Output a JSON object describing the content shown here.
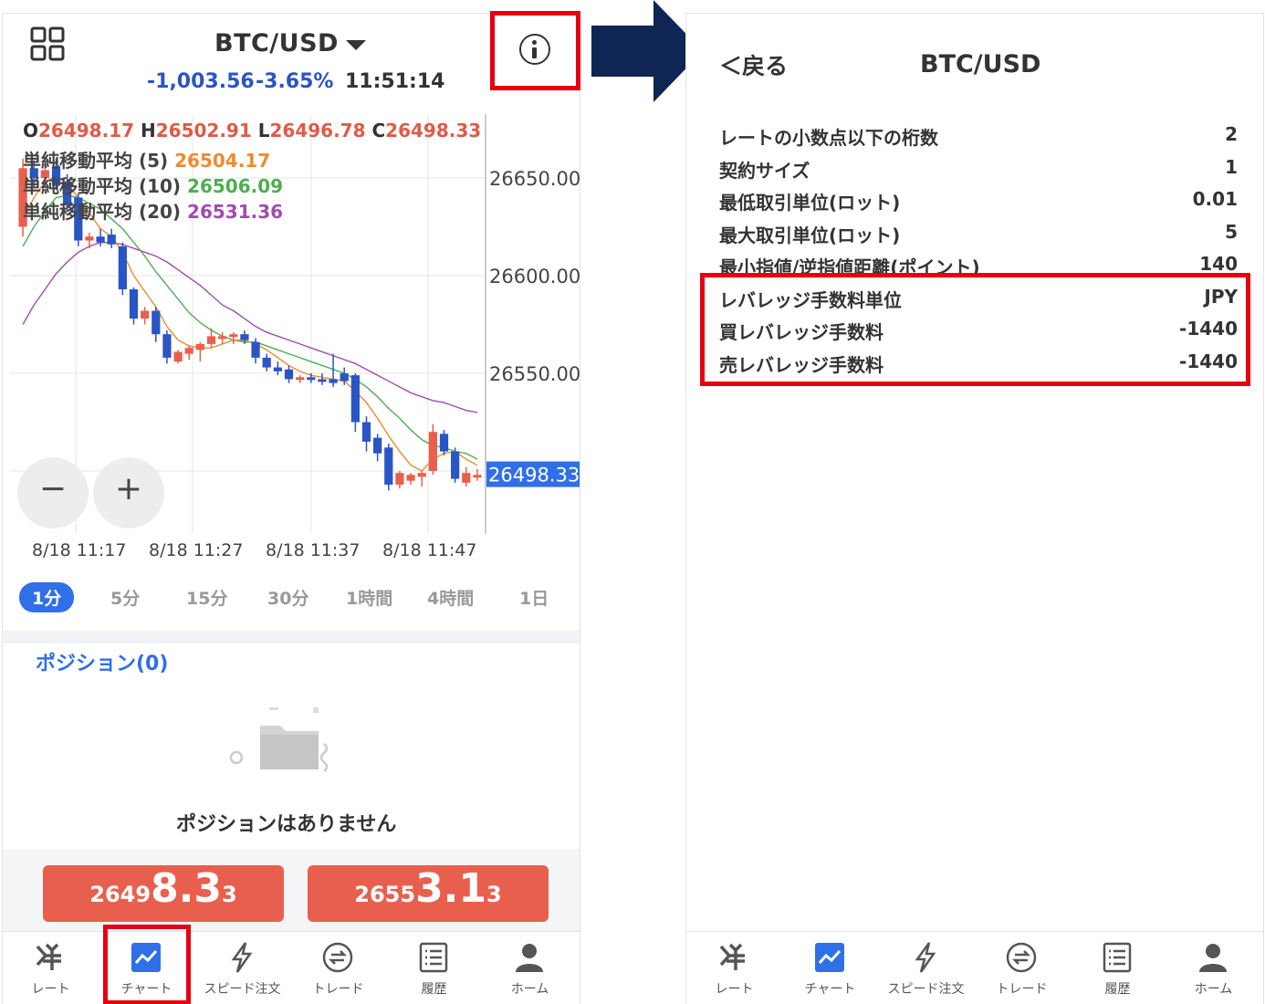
{
  "left": {
    "title": "BTC/USD",
    "change_abs": "-1,003.56",
    "change_pct": "-3.65%",
    "time": "11:51:14",
    "ohlc": {
      "o_key": "O",
      "o_val": "26498.17",
      "h_key": "H",
      "h_val": "26502.91",
      "l_key": "L",
      "l_val": "26496.78",
      "c_key": "C",
      "c_val": "26498.33"
    },
    "ma": [
      {
        "label": "単純移動平均 (5)",
        "value": "26504.17",
        "color": "#f08a2c"
      },
      {
        "label": "単純移動平均 (10)",
        "value": "26506.09",
        "color": "#4caf50"
      },
      {
        "label": "単純移動平均 (20)",
        "value": "26531.36",
        "color": "#a24ab0"
      }
    ],
    "zoom_out": "−",
    "zoom_in": "+",
    "timeframes": [
      "1分",
      "5分",
      "15分",
      "30分",
      "1時間",
      "4時間",
      "1日"
    ],
    "positions_title": "ポジション(0)",
    "empty_message": "ポジションはありません",
    "sell_price": {
      "small": "2649",
      "big": "8.3",
      "tail": "3"
    },
    "buy_price": {
      "small": "2655",
      "big": "3.1",
      "tail": "3"
    }
  },
  "chart_data": {
    "type": "candlestick",
    "y_ticks": [
      "26650.00",
      "26600.00",
      "26550.00"
    ],
    "current_price_label": "26498.33",
    "x_ticks": [
      "8/18 11:17",
      "8/18 11:27",
      "8/18 11:37",
      "8/18 11:47"
    ],
    "ylim": [
      26480,
      26700
    ],
    "candles": [
      {
        "o": 26655,
        "h": 26660,
        "l": 26620,
        "c": 26625,
        "up": true
      },
      {
        "o": 26655,
        "h": 26659,
        "l": 26645,
        "c": 26650,
        "up": false
      },
      {
        "o": 26654,
        "h": 26658,
        "l": 26648,
        "c": 26650,
        "up": true
      },
      {
        "o": 26656,
        "h": 26660,
        "l": 26644,
        "c": 26646,
        "up": false
      },
      {
        "o": 26648,
        "h": 26652,
        "l": 26634,
        "c": 26636,
        "up": false
      },
      {
        "o": 26640,
        "h": 26642,
        "l": 26615,
        "c": 26618,
        "up": false
      },
      {
        "o": 26618,
        "h": 26622,
        "l": 26614,
        "c": 26620,
        "up": true
      },
      {
        "o": 26620,
        "h": 26624,
        "l": 26615,
        "c": 26617,
        "up": false
      },
      {
        "o": 26621,
        "h": 26624,
        "l": 26614,
        "c": 26616,
        "up": false
      },
      {
        "o": 26615,
        "h": 26617,
        "l": 26590,
        "c": 26593,
        "up": false
      },
      {
        "o": 26593,
        "h": 26594,
        "l": 26575,
        "c": 26578,
        "up": false
      },
      {
        "o": 26578,
        "h": 26584,
        "l": 26575,
        "c": 26582,
        "up": true
      },
      {
        "o": 26582,
        "h": 26584,
        "l": 26566,
        "c": 26570,
        "up": false
      },
      {
        "o": 26570,
        "h": 26572,
        "l": 26555,
        "c": 26558,
        "up": false
      },
      {
        "o": 26556,
        "h": 26562,
        "l": 26555,
        "c": 26561,
        "up": true
      },
      {
        "o": 26560,
        "h": 26564,
        "l": 26557,
        "c": 26563,
        "up": true
      },
      {
        "o": 26562,
        "h": 26566,
        "l": 26556,
        "c": 26565,
        "up": true
      },
      {
        "o": 26565,
        "h": 26573,
        "l": 26563,
        "c": 26569,
        "up": true
      },
      {
        "o": 26569,
        "h": 26571,
        "l": 26565,
        "c": 26568,
        "up": true
      },
      {
        "o": 26569,
        "h": 26571,
        "l": 26565,
        "c": 26570,
        "up": true
      },
      {
        "o": 26570,
        "h": 26572,
        "l": 26565,
        "c": 26567,
        "up": false
      },
      {
        "o": 26566,
        "h": 26568,
        "l": 26555,
        "c": 26558,
        "up": false
      },
      {
        "o": 26558,
        "h": 26560,
        "l": 26551,
        "c": 26553,
        "up": false
      },
      {
        "o": 26553,
        "h": 26556,
        "l": 26549,
        "c": 26551,
        "up": false
      },
      {
        "o": 26552,
        "h": 26554,
        "l": 26545,
        "c": 26547,
        "up": false
      },
      {
        "o": 26547,
        "h": 26549,
        "l": 26545,
        "c": 26548,
        "up": true
      },
      {
        "o": 26548,
        "h": 26550,
        "l": 26545,
        "c": 26547,
        "up": false
      },
      {
        "o": 26547,
        "h": 26550,
        "l": 26544,
        "c": 26546,
        "up": false
      },
      {
        "o": 26547,
        "h": 26560,
        "l": 26543,
        "c": 26545,
        "up": false
      },
      {
        "o": 26550,
        "h": 26553,
        "l": 26544,
        "c": 26546,
        "up": false
      },
      {
        "o": 26549,
        "h": 26550,
        "l": 26520,
        "c": 26525,
        "up": false
      },
      {
        "o": 26525,
        "h": 26528,
        "l": 26510,
        "c": 26515,
        "up": false
      },
      {
        "o": 26517,
        "h": 26519,
        "l": 26505,
        "c": 26509,
        "up": false
      },
      {
        "o": 26512,
        "h": 26514,
        "l": 26490,
        "c": 26493,
        "up": false
      },
      {
        "o": 26493,
        "h": 26500,
        "l": 26491,
        "c": 26499,
        "up": true
      },
      {
        "o": 26495,
        "h": 26499,
        "l": 26493,
        "c": 26498,
        "up": true
      },
      {
        "o": 26497,
        "h": 26500,
        "l": 26492,
        "c": 26499,
        "up": true
      },
      {
        "o": 26500,
        "h": 26524,
        "l": 26498,
        "c": 26520,
        "up": true
      },
      {
        "o": 26519,
        "h": 26521,
        "l": 26508,
        "c": 26510,
        "up": false
      },
      {
        "o": 26510,
        "h": 26512,
        "l": 26494,
        "c": 26496,
        "up": false
      },
      {
        "o": 26494,
        "h": 26502,
        "l": 26492,
        "c": 26499,
        "up": true
      },
      {
        "o": 26498,
        "h": 26501,
        "l": 26495,
        "c": 26498,
        "up": true
      }
    ],
    "ma5": [
      26628,
      26640,
      26648,
      26651,
      26647,
      26640,
      26632,
      26624,
      26620,
      26612,
      26600,
      26592,
      26584,
      26574,
      26567,
      26564,
      26563,
      26563,
      26565,
      26567,
      26567,
      26565,
      26562,
      26558,
      26554,
      26551,
      26549,
      26548,
      26547,
      26546,
      26541,
      26535,
      26527,
      26518,
      26510,
      26503,
      26500,
      26506,
      26509,
      26510,
      26506,
      26503
    ],
    "ma10": [
      26615,
      26625,
      26633,
      26640,
      26641,
      26640,
      26637,
      26634,
      26629,
      26624,
      26617,
      26610,
      26602,
      26595,
      26588,
      26581,
      26576,
      26572,
      26569,
      26567,
      26566,
      26566,
      26564,
      26562,
      26560,
      26558,
      26556,
      26554,
      26552,
      26550,
      26547,
      26543,
      26538,
      26532,
      26527,
      26521,
      26516,
      26513,
      26512,
      26510,
      26509,
      26506
    ],
    "ma20": [
      26575,
      26585,
      26593,
      26601,
      26607,
      26612,
      26615,
      26617,
      26617,
      26616,
      26614,
      26612,
      26610,
      26607,
      26603,
      26599,
      26595,
      26590,
      26585,
      26582,
      26578,
      26574,
      26571,
      26569,
      26567,
      26565,
      26563,
      26561,
      26559,
      26557,
      26555,
      26552,
      26549,
      26546,
      26543,
      26540,
      26538,
      26536,
      26535,
      26533,
      26531,
      26530
    ]
  },
  "nav": [
    {
      "label": "レート",
      "icon": "yen-icon"
    },
    {
      "label": "チャート",
      "icon": "chart-icon"
    },
    {
      "label": "スピード注文",
      "icon": "lightning-icon"
    },
    {
      "label": "トレード",
      "icon": "exchange-icon"
    },
    {
      "label": "履歴",
      "icon": "list-icon"
    },
    {
      "label": "ホーム",
      "icon": "person-icon"
    }
  ],
  "right": {
    "back_label": "＜戻る",
    "title": "BTC/USD",
    "rows": [
      {
        "label": "レートの小数点以下の桁数",
        "value": "2"
      },
      {
        "label": "契約サイズ",
        "value": "1"
      },
      {
        "label": "最低取引単位(ロット)",
        "value": "0.01"
      },
      {
        "label": "最大取引単位(ロット)",
        "value": "5"
      },
      {
        "label": "最小指値/逆指値距離(ポイント)",
        "value": "140"
      },
      {
        "label": "レバレッジ手数料単位",
        "value": "JPY"
      },
      {
        "label": "買レバレッジ手数料",
        "value": "-1440"
      },
      {
        "label": "売レバレッジ手数料",
        "value": "-1440"
      }
    ]
  },
  "colors": {
    "accent": "#2f6fe8",
    "down": "#2a55c4",
    "up": "#e8604d",
    "highlight": "#e60012",
    "arrow": "#0f2554"
  }
}
